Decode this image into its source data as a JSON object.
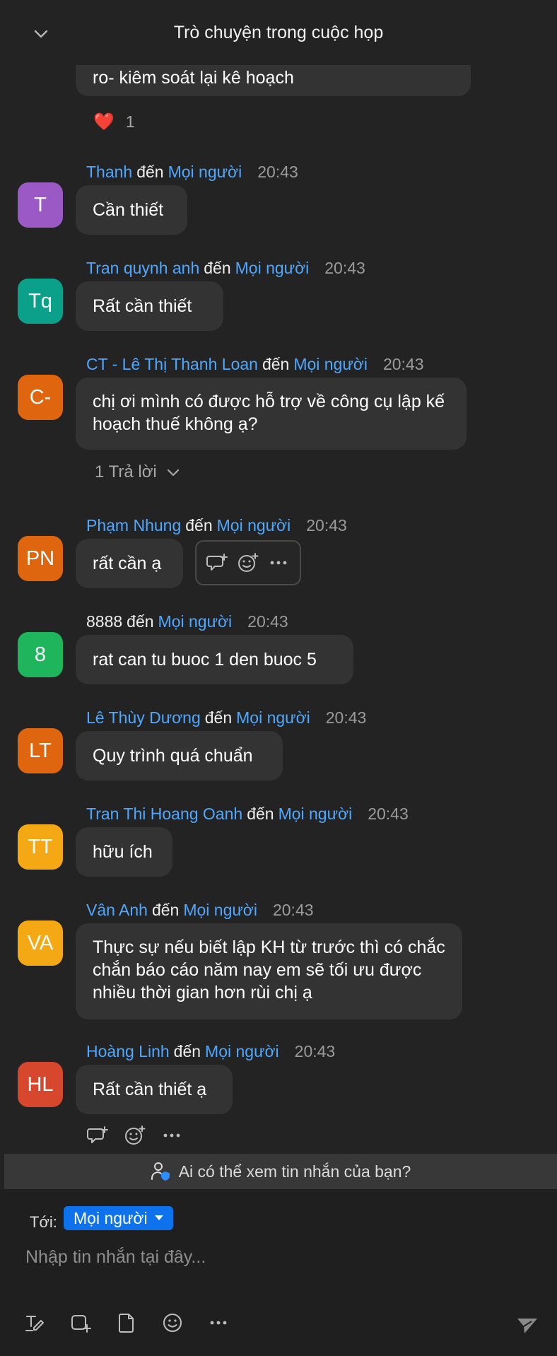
{
  "header": {
    "title": "Trò chuyện trong cuộc họp"
  },
  "top_message": {
    "text": "ro- kiêm soát lại kê hoạch",
    "reaction_emoji": "❤️",
    "reaction_count": "1"
  },
  "messages": [
    {
      "sender": "Thanh",
      "to_word": "đến",
      "recipient": "Mọi người",
      "time": "20:43",
      "initials": "T",
      "avatar_color": "#9b59c5",
      "text": "Cần thiết"
    },
    {
      "sender": "Tran quynh anh",
      "to_word": "đến",
      "recipient": "Mọi người",
      "time": "20:43",
      "initials": "Tq",
      "avatar_color": "#0aa08a",
      "text": "Rất cần thiết"
    },
    {
      "sender": "CT - Lê Thị Thanh Loan",
      "to_word": "đến",
      "recipient": "Mọi người",
      "time": "20:43",
      "initials": "C-",
      "avatar_color": "#e0650f",
      "text": "chị ơi mình có được hỗ trợ về công cụ lập kế hoạch thuế không ạ?",
      "reply_count": "1 Trả lời"
    },
    {
      "sender": "Phạm Nhung",
      "to_word": "đến",
      "recipient": "Mọi người",
      "time": "20:43",
      "initials": "PN",
      "avatar_color": "#e0650f",
      "text": "rất cần ạ"
    },
    {
      "sender": "8888",
      "to_word": "đến",
      "recipient": "Mọi người",
      "time": "20:43",
      "initials": "8",
      "avatar_color": "#1fb55c",
      "text": "rat can tu buoc 1 den buoc 5"
    },
    {
      "sender": "Lê Thùy Dương",
      "to_word": "đến",
      "recipient": "Mọi người",
      "time": "20:43",
      "initials": "LT",
      "avatar_color": "#e0650f",
      "text": "Quy trình quá chuẩn"
    },
    {
      "sender": "Tran Thi Hoang Oanh",
      "to_word": "đến",
      "recipient": "Mọi người",
      "time": "20:43",
      "initials": "TT",
      "avatar_color": "#f3a814",
      "text": "hữu ích"
    },
    {
      "sender": "Vân Anh",
      "to_word": "đến",
      "recipient": "Mọi người",
      "time": "20:43",
      "initials": "VA",
      "avatar_color": "#f3a814",
      "text": "Thực sự nếu biết lập KH từ trước thì có chắc chắn báo cáo năm nay em sẽ tối ưu được nhiều thời gian hơn rùi chị ạ"
    },
    {
      "sender": "Hoàng Linh",
      "to_word": "đến",
      "recipient": "Mọi người",
      "time": "20:43",
      "initials": "HL",
      "avatar_color": "#d6472e",
      "text": "Rất cần thiết ạ"
    }
  ],
  "privacy_notice": "Ai có thể xem tin nhắn của bạn?",
  "composer": {
    "to_label": "Tới:",
    "recipient": "Mọi người",
    "placeholder": "Nhập tin nhắn tại đây..."
  }
}
